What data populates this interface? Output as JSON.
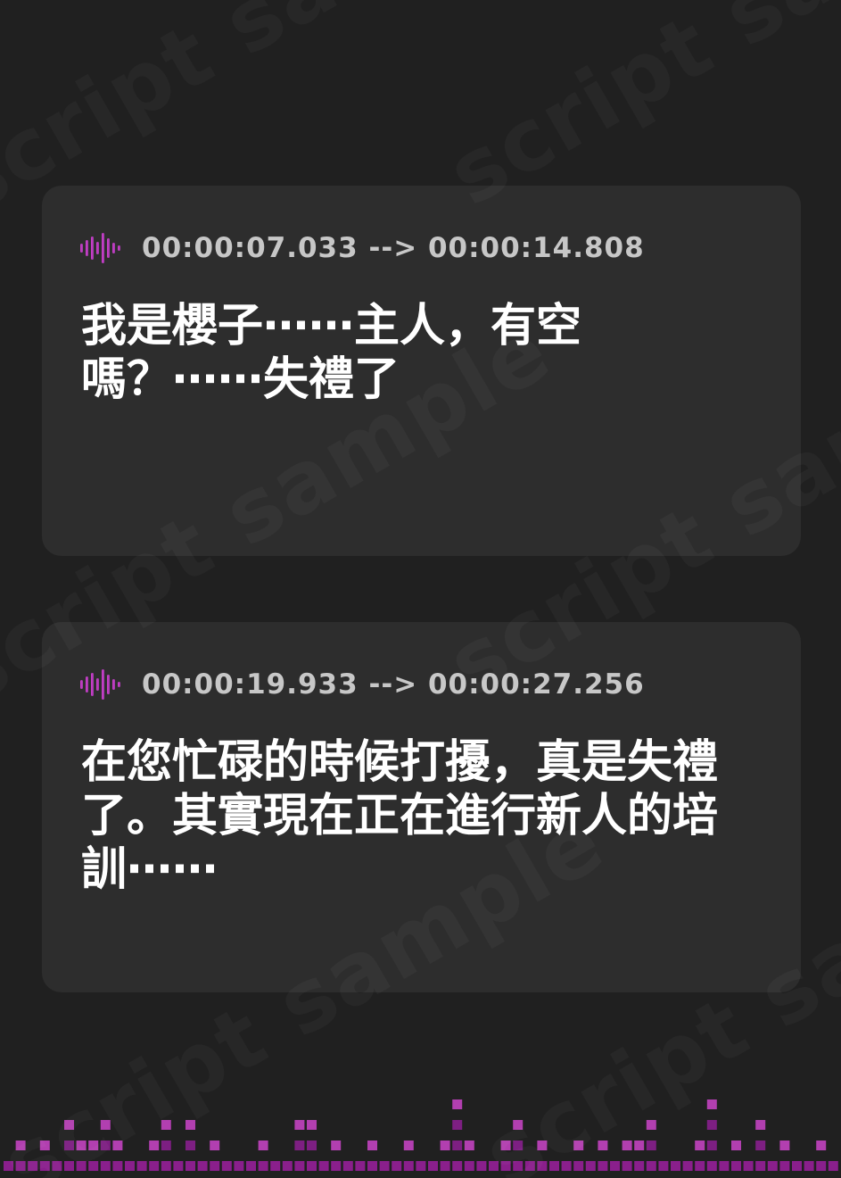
{
  "watermark": "script sample",
  "colors": {
    "background": "#202020",
    "card": "#2d2d2d",
    "timestamp": "#c7c7c7",
    "text": "#ffffff",
    "accent_magenta": "#d13fd0",
    "accent_purple": "#7d1f82",
    "accent_light": "#b23fb0"
  },
  "cues": [
    {
      "icon": "sound-wave-icon",
      "timestamp": "00:00:07.033 --> 00:00:14.808",
      "text": "我是櫻子⋯⋯主人，有空嗎？⋯⋯失禮了"
    },
    {
      "icon": "sound-wave-icon",
      "timestamp": "00:00:19.933 --> 00:00:27.256",
      "text": "在您忙碌的時候打擾，真是失禮了。其實現在正在進行新人的培訓⋯⋯"
    }
  ],
  "equalizer": {
    "icon": "equalizer-decoration",
    "levels": [
      1,
      2,
      1,
      2,
      1,
      3,
      2,
      2,
      3,
      2,
      1,
      1,
      2,
      3,
      1,
      3,
      1,
      2,
      1,
      1,
      1,
      2,
      1,
      1,
      3,
      3,
      1,
      2,
      1,
      1,
      2,
      1,
      1,
      2,
      1,
      1,
      2,
      4,
      2,
      1,
      1,
      2,
      3,
      1,
      2,
      1,
      1,
      2,
      1,
      2,
      1,
      2,
      2,
      3,
      1,
      1,
      1,
      2,
      4,
      1,
      2,
      1,
      3,
      1,
      2,
      1,
      1,
      2,
      1,
      1
    ]
  }
}
